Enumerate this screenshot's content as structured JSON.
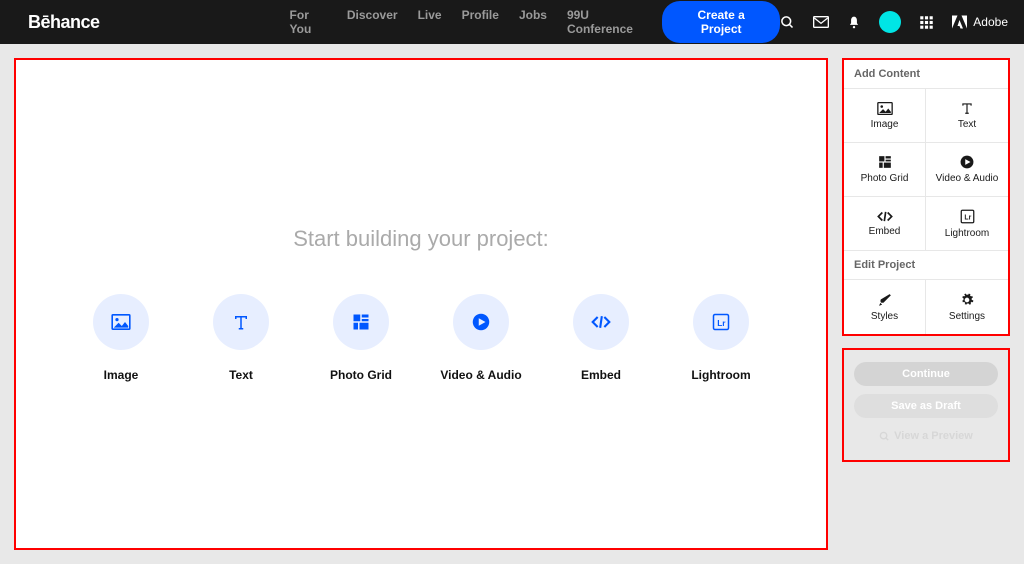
{
  "logo": "Bēhance",
  "nav": {
    "for_you": "For You",
    "discover": "Discover",
    "live": "Live",
    "profile": "Profile",
    "jobs": "Jobs",
    "conference": "99U Conference",
    "create": "Create a Project",
    "adobe": "Adobe"
  },
  "canvas": {
    "title": "Start building your project:",
    "items": {
      "image": "Image",
      "text": "Text",
      "photo_grid": "Photo Grid",
      "video_audio": "Video & Audio",
      "embed": "Embed",
      "lightroom": "Lightroom"
    }
  },
  "sidebar": {
    "add_title": "Add Content",
    "edit_title": "Edit Project",
    "add": {
      "image": "Image",
      "text": "Text",
      "photo_grid": "Photo Grid",
      "video_audio": "Video & Audio",
      "embed": "Embed",
      "lightroom": "Lightroom"
    },
    "edit": {
      "styles": "Styles",
      "settings": "Settings"
    }
  },
  "actions": {
    "continue": "Continue",
    "save_draft": "Save as Draft",
    "preview": "View a Preview"
  }
}
